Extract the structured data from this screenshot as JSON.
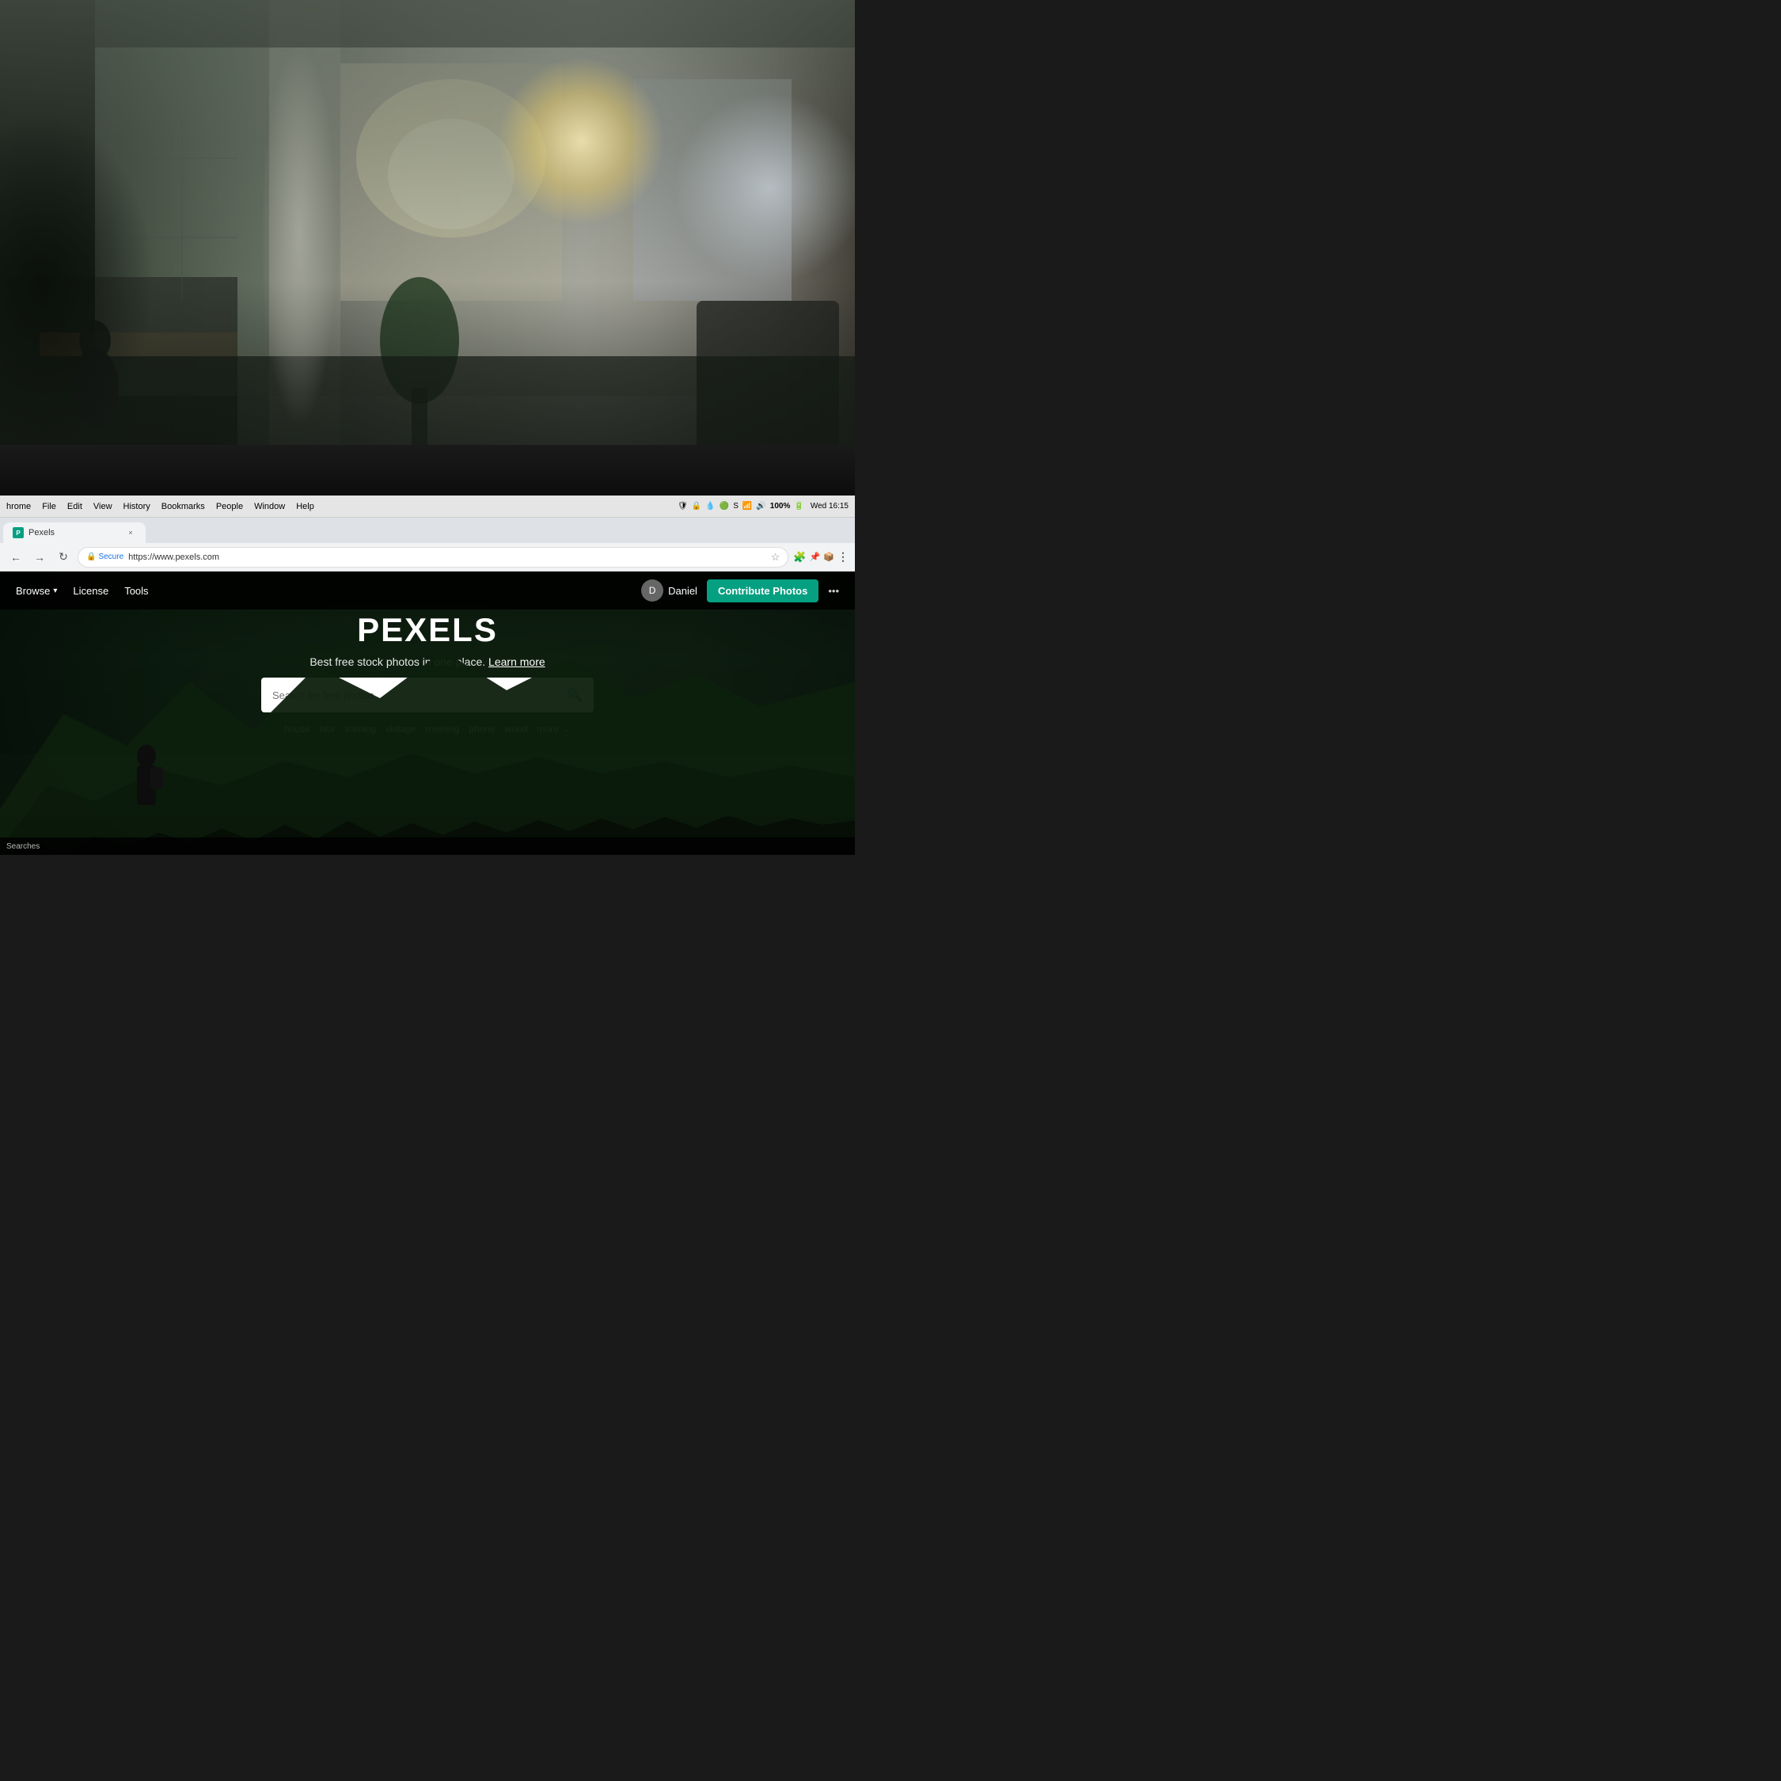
{
  "background": {
    "type": "office_photo"
  },
  "monitor": {
    "bezel_color": "#111"
  },
  "menu_bar": {
    "app_name": "hrome",
    "items": [
      "File",
      "Edit",
      "View",
      "History",
      "Bookmarks",
      "People",
      "Window",
      "Help"
    ],
    "right_items": [
      "Wed 16:15"
    ]
  },
  "tab_bar": {
    "active_tab": {
      "favicon_text": "P",
      "title": "Pexels",
      "close_symbol": "×"
    }
  },
  "browser_toolbar": {
    "back_symbol": "←",
    "forward_symbol": "→",
    "refresh_symbol": "↻",
    "secure_label": "Secure",
    "url": "https://www.pexels.com",
    "more_symbol": "⋮"
  },
  "pexels": {
    "nav": {
      "browse_label": "Browse",
      "browse_arrow": "▾",
      "license_label": "License",
      "tools_label": "Tools",
      "user_name": "Daniel",
      "contribute_label": "Contribute Photos",
      "more_symbol": "•••"
    },
    "hero": {
      "title": "PEXELS",
      "subtitle": "Best free stock photos in one place.",
      "learn_more": "Learn more",
      "search_placeholder": "Search for free photos...",
      "search_icon": "🔍",
      "tags": [
        "house",
        "blur",
        "training",
        "vintage",
        "meeting",
        "phone",
        "wood"
      ],
      "more_label": "more →"
    }
  },
  "taskbar": {
    "searches_label": "Searches"
  }
}
